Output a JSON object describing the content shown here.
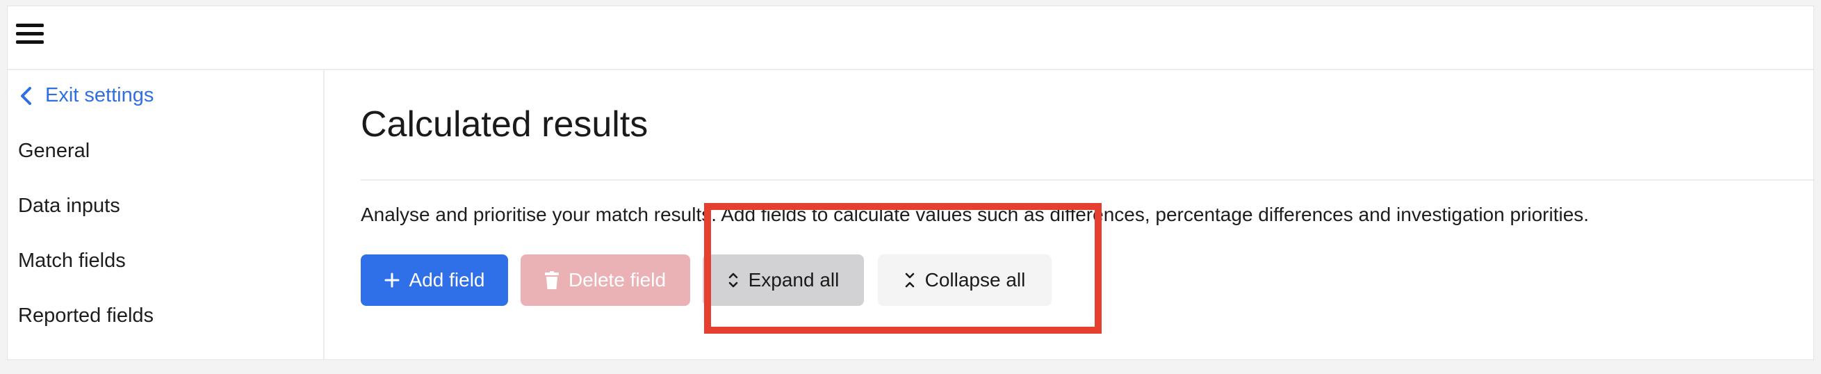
{
  "header": {
    "menu_icon": "hamburger-menu-icon"
  },
  "sidebar": {
    "exit_label": "Exit settings",
    "exit_icon": "chevron-left-icon",
    "items": [
      {
        "label": "General"
      },
      {
        "label": "Data inputs"
      },
      {
        "label": "Match fields"
      },
      {
        "label": "Reported fields"
      }
    ]
  },
  "main": {
    "title": "Calculated results",
    "description": "Analyse and prioritise your match results. Add fields to calculate values such as differences, percentage differences and investigation priorities.",
    "buttons": {
      "add": {
        "label": "Add field",
        "icon": "plus-icon"
      },
      "delete": {
        "label": "Delete field",
        "icon": "trash-icon",
        "disabled": true
      },
      "expand": {
        "label": "Expand all",
        "icon": "expand-chevrons-icon"
      },
      "collapse": {
        "label": "Collapse all",
        "icon": "collapse-chevrons-icon"
      }
    }
  },
  "colors": {
    "accent": "#2f6fe8",
    "link": "#2f6fe4",
    "delete_disabled": "#ebb2b5",
    "highlight": "#e5402f"
  }
}
